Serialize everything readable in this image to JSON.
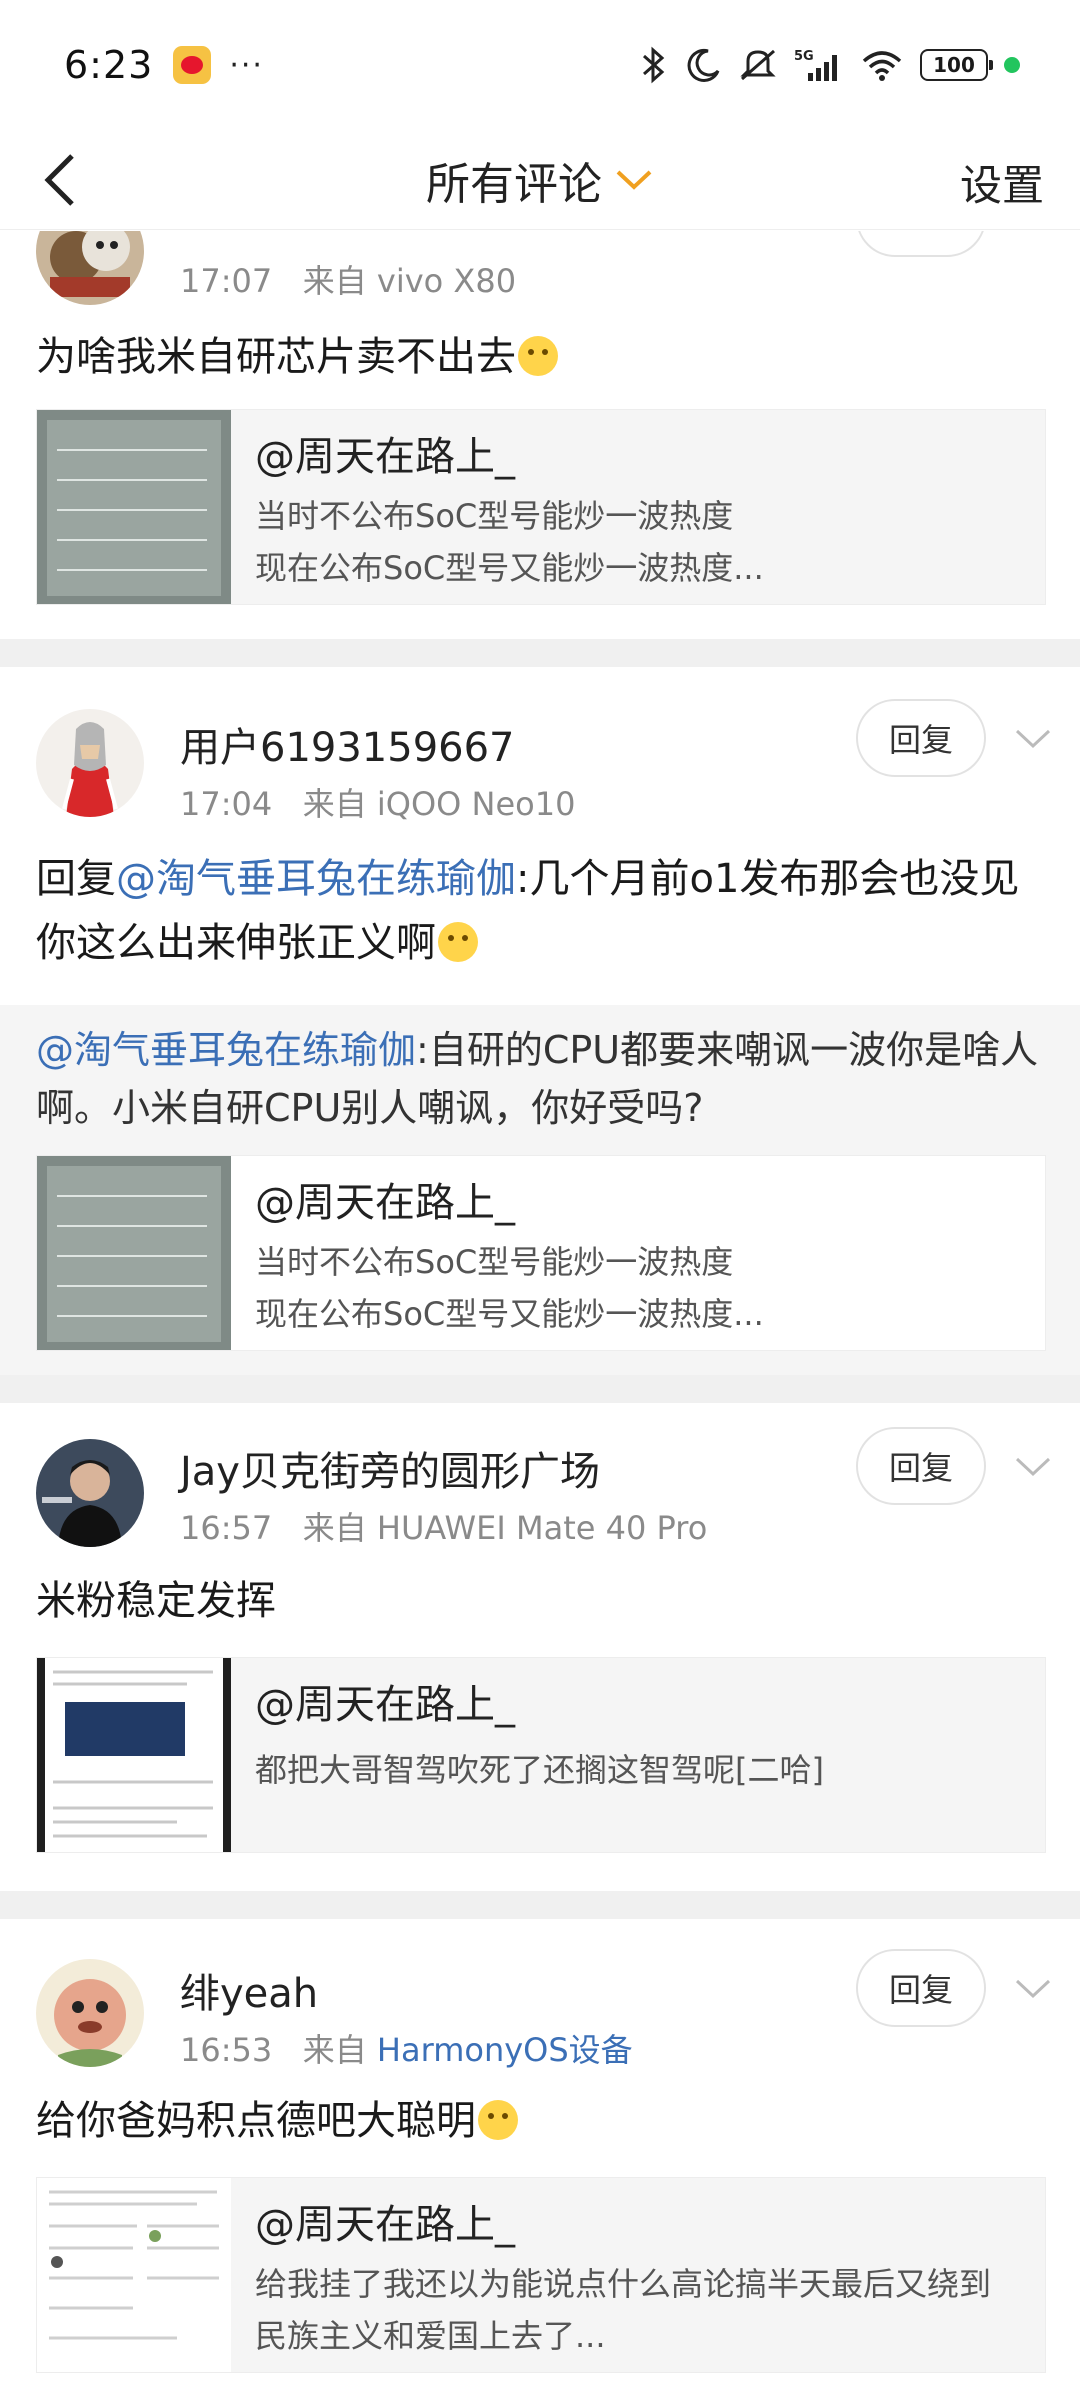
{
  "status_bar": {
    "time": "6:23",
    "more": "···",
    "network": "5G",
    "battery": "100"
  },
  "nav": {
    "title": "所有评论",
    "settings": "设置"
  },
  "top_card": {
    "time": "17:07",
    "source": "来自 vivo X80",
    "text": "为啥我米自研芯片卖不出去",
    "card_title": "@周天在路上_",
    "card_line1": "当时不公布SoC型号能炒一波热度",
    "card_line2": "现在公布SoC型号又能炒一波热度..."
  },
  "comments": [
    {
      "name": "用户6193159667",
      "time": "17:04",
      "source": "来自 iQOO Neo10",
      "reply": "回复",
      "text_prefix": "回复",
      "text_mention": "@淘气垂耳兔在练瑜伽",
      "text_rest": ":几个月前o1发布那会也没见你这么出来伸张正义啊",
      "quote_mention": "@淘气垂耳兔在练瑜伽",
      "quote_rest": ":自研的CPU都要来嘲讽一波你是啥人啊。小米自研CPU别人嘲讽，你好受吗?",
      "card_title": "@周天在路上_",
      "card_line1": "当时不公布SoC型号能炒一波热度",
      "card_line2": "现在公布SoC型号又能炒一波热度..."
    },
    {
      "name": "Jay贝克街旁的圆形广场",
      "time": "16:57",
      "source": "来自 HUAWEI Mate 40 Pro",
      "reply": "回复",
      "text": "米粉稳定发挥",
      "card_title": "@周天在路上_",
      "card_line1": "都把大哥智驾吹死了还搁这智驾呢[二哈]"
    },
    {
      "name": "绯yeah",
      "time": "16:53",
      "source_prefix": "来自",
      "source_device": "HarmonyOS设备",
      "reply": "回复",
      "text": "给你爸妈积点德吧大聪明",
      "card_title": "@周天在路上_",
      "card_line1": "给我挂了我还以为能说点什么高论搞半天最后又绕到",
      "card_line2": "民族主义和爱国上去了..."
    }
  ],
  "colors": {
    "accent_orange": "#f0a020",
    "link_blue": "#3b6fb6",
    "separator": "#f0f0f0"
  }
}
